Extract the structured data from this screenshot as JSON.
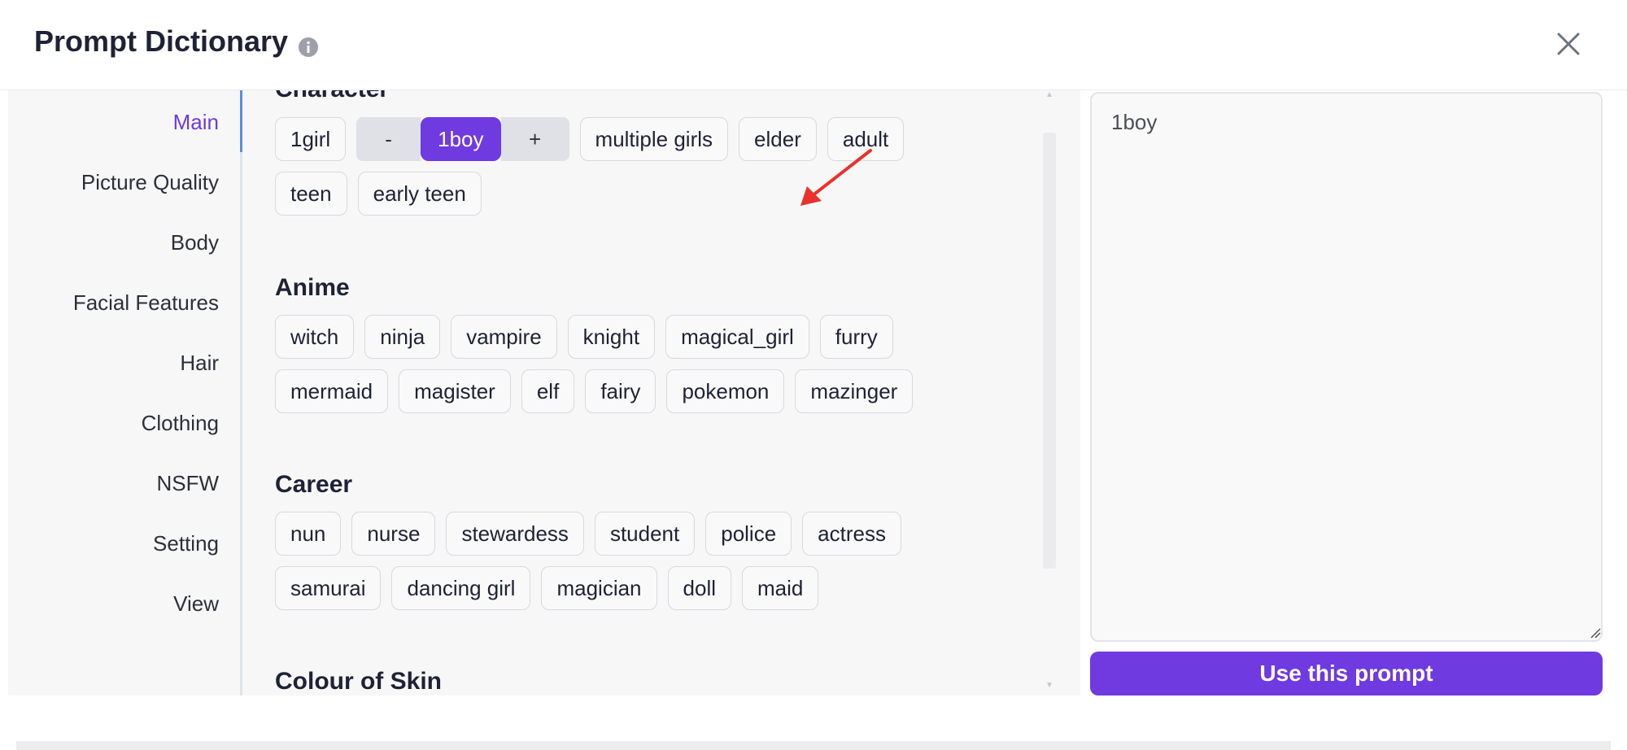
{
  "header": {
    "title": "Prompt Dictionary",
    "info_icon": "info-icon",
    "close_icon": "close-icon"
  },
  "sidebar": {
    "items": [
      {
        "label": "Main",
        "active": true
      },
      {
        "label": "Picture Quality"
      },
      {
        "label": "Body"
      },
      {
        "label": "Facial Features"
      },
      {
        "label": "Hair"
      },
      {
        "label": "Clothing"
      },
      {
        "label": "NSFW"
      },
      {
        "label": "Setting"
      },
      {
        "label": "View"
      }
    ]
  },
  "sections": {
    "character": {
      "title": "Character",
      "tags": [
        "1girl",
        "multiple girls",
        "elder",
        "adult",
        "teen",
        "early teen"
      ],
      "selected": {
        "minus": "-",
        "label": "1boy",
        "plus": "+"
      }
    },
    "anime": {
      "title": "Anime",
      "tags": [
        "witch",
        "ninja",
        "vampire",
        "knight",
        "magical_girl",
        "furry",
        "mermaid",
        "magister",
        "elf",
        "fairy",
        "pokemon",
        "mazinger"
      ]
    },
    "career": {
      "title": "Career",
      "tags": [
        "nun",
        "nurse",
        "stewardess",
        "student",
        "police",
        "actress",
        "samurai",
        "dancing girl",
        "magician",
        "doll",
        "maid"
      ]
    },
    "colour_of_skin": {
      "title": "Colour of Skin"
    }
  },
  "prompt": {
    "value": "1boy"
  },
  "use_button": "Use this prompt",
  "colors": {
    "accent": "#6f3ae0",
    "arrow": "#e8322b"
  }
}
